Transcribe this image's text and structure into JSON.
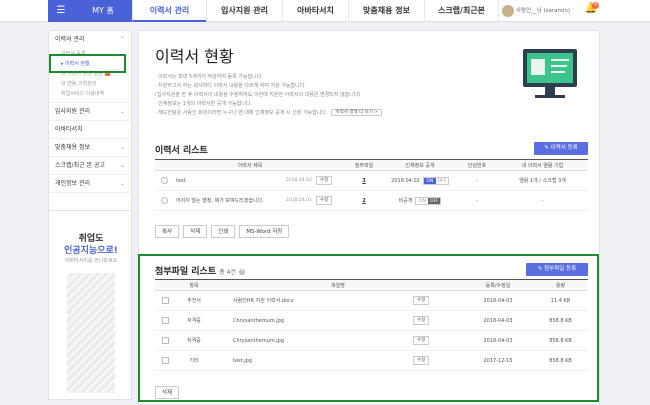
{
  "nav": {
    "menu_icon": "hamburger-icon",
    "myhome": "MY 홈",
    "items": [
      "이력서 관리",
      "입사지원 관리",
      "아바타서치",
      "맞춤채용 정보",
      "스크랩/최근본"
    ],
    "profile": "사람인__님 (saramin)",
    "notification_count": "9"
  },
  "sidebar": {
    "resume_section": "이력서 관리",
    "resume_items": [
      "이력서 등록",
      "이력서 현황",
      "내 이력서 상태 설정",
      "내 연봉 이력관리",
      "취업서비스 이용내역"
    ],
    "sections": [
      "입사지원 관리",
      "아바타서치",
      "맞춤채용 정보",
      "스크랩/최근 본 공고",
      "개인정보 관리"
    ],
    "banner": {
      "line1": "취업도",
      "line2": "인공지능으로!",
      "line3": "아바타서치를 만나보세요"
    }
  },
  "main": {
    "title": "이력서 현황",
    "notes": [
      "· 이력서는 최대 5개까지 작성하여 등록 가능합니다.",
      "· 지원하고자 하는 회사마다 이력서 내용을 다르게 하여 지원 가능합니다.",
      "  (입사지원을 한 후 이력서의 내용을 수정하여도 이전에 지원한 이력서의 내용은 변경되지 않습니다)",
      "· 인재정보는 1개의 이력서만 공개 가능합니다.",
      "· 헤드헌팅은 사람인 회원이라면 누구나 엔 대해 인재정보 공개 시 신청 가능합니다."
    ],
    "notes_more": "이력서 정책 더 보기 >",
    "resume_list": {
      "title": "이력서 리스트",
      "register_btn": "이력서 등록",
      "headers": [
        "이력서 제목",
        "첨부파일",
        "인재정보 공개",
        "안심번호",
        "내 이력서 열람 기업"
      ],
      "rows": [
        {
          "title": "test",
          "date": "2018.04.03",
          "edit": "수정",
          "files": "3",
          "public": "2018.04.02",
          "on": "ON",
          "off": "OFF",
          "safe": "-",
          "viewers": "열람 1개 / 스크랩 3개",
          "active": "on"
        },
        {
          "title": "어지지 않는 열정, 제가 보여드리겠습니다.",
          "date": "2018.04.03",
          "edit": "수정",
          "files": "2",
          "public": "비공개",
          "on": "ON",
          "off": "OFF",
          "safe": "-",
          "viewers": "-",
          "active": "off"
        }
      ],
      "actions": [
        "복사",
        "삭제",
        "인쇄",
        "MS-Word 저장"
      ]
    },
    "attach_list": {
      "title": "첨부파일 리스트",
      "count_label": "총 4건",
      "register_btn": "첨부파일 등록",
      "headers": [
        "항목",
        "파일명",
        "등록/수정일",
        "용량"
      ],
      "rows": [
        {
          "type": "추천서",
          "name": "사람인HR 지원 이력서.docx",
          "edit": "수정",
          "date": "2018-04-03",
          "size": "11.4 KB"
        },
        {
          "type": "자격증",
          "name": "Chrysanthemum.jpg",
          "edit": "수정",
          "date": "2018-04-03",
          "size": "858.8 KB"
        },
        {
          "type": "자격증",
          "name": "Chrysanthemum.jpg",
          "edit": "수정",
          "date": "2018-04-03",
          "size": "858.8 KB"
        },
        {
          "type": "기타",
          "name": "test.jpg",
          "edit": "수정",
          "date": "2017-12-15",
          "size": "858.8 KB"
        }
      ],
      "delete_btn": "삭제"
    }
  },
  "colors": {
    "brand": "#4a61d8",
    "highlight": "#1e8c2e",
    "button": "#5b6ee1"
  }
}
